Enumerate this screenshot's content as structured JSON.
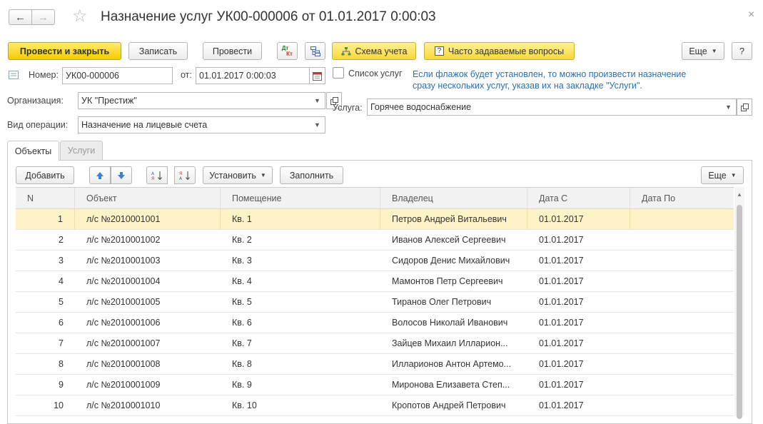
{
  "window": {
    "title": "Назначение услуг УК00-000006 от 01.01.2017 0:00:03",
    "back_glyph": "←",
    "forward_glyph": "→",
    "star_glyph": "☆",
    "close_glyph": "×"
  },
  "toolbar": {
    "post_close": "Провести и закрыть",
    "save": "Записать",
    "post": "Провести",
    "dt_kt_top": "Дт",
    "dt_kt_bottom": "Кт",
    "scheme": "Схема учета",
    "faq": "Часто задаваемые вопросы",
    "more": "Еще",
    "help": "?"
  },
  "form": {
    "number_label": "Номер:",
    "number_value": "УК00-000006",
    "date_label": "от:",
    "date_value": "01.01.2017  0:00:03",
    "org_label": "Организация:",
    "org_value": "УК \"Престиж\"",
    "op_label": "Вид операции:",
    "op_value": "Назначение на лицевые счета",
    "services_list_label": "Список услуг",
    "services_hint_1": "Если флажок будет установлен, то можно произвести назначение",
    "services_hint_2": "сразу нескольких услуг, указав их на закладке \"Услуги\".",
    "service_label": "Услуга:",
    "service_value": "Горячее водоснабжение"
  },
  "tabs": [
    {
      "label": "Объекты",
      "active": true
    },
    {
      "label": "Услуги",
      "active": false
    }
  ],
  "table_toolbar": {
    "add": "Добавить",
    "set": "Установить",
    "fill": "Заполнить",
    "more": "Еще"
  },
  "table": {
    "columns": [
      "N",
      "Объект",
      "Помещение",
      "Владелец",
      "Дата С",
      "Дата По"
    ],
    "rows": [
      {
        "n": "1",
        "object": "л/с №2010001001",
        "room": "Кв. 1",
        "owner": "Петров Андрей Витальевич",
        "date_from": "01.01.2017",
        "date_to": ""
      },
      {
        "n": "2",
        "object": "л/с №2010001002",
        "room": "Кв. 2",
        "owner": "Иванов Алексей Сергеевич",
        "date_from": "01.01.2017",
        "date_to": ""
      },
      {
        "n": "3",
        "object": "л/с №2010001003",
        "room": "Кв. 3",
        "owner": "Сидоров Денис Михайлович",
        "date_from": "01.01.2017",
        "date_to": ""
      },
      {
        "n": "4",
        "object": "л/с №2010001004",
        "room": "Кв. 4",
        "owner": "Мамонтов Петр Сергеевич",
        "date_from": "01.01.2017",
        "date_to": ""
      },
      {
        "n": "5",
        "object": "л/с №2010001005",
        "room": "Кв. 5",
        "owner": "Тиранов Олег Петрович",
        "date_from": "01.01.2017",
        "date_to": ""
      },
      {
        "n": "6",
        "object": "л/с №2010001006",
        "room": "Кв. 6",
        "owner": "Волосов Николай Иванович",
        "date_from": "01.01.2017",
        "date_to": ""
      },
      {
        "n": "7",
        "object": "л/с №2010001007",
        "room": "Кв. 7",
        "owner": "Зайцев Михаил Илларион...",
        "date_from": "01.01.2017",
        "date_to": ""
      },
      {
        "n": "8",
        "object": "л/с №2010001008",
        "room": "Кв. 8",
        "owner": "Илларионов Антон Артемо...",
        "date_from": "01.01.2017",
        "date_to": ""
      },
      {
        "n": "9",
        "object": "л/с №2010001009",
        "room": "Кв. 9",
        "owner": "Миронова Елизавета Степ...",
        "date_from": "01.01.2017",
        "date_to": ""
      },
      {
        "n": "10",
        "object": "л/с №2010001010",
        "room": "Кв. 10",
        "owner": "Кропотов Андрей Петрович",
        "date_from": "01.01.2017",
        "date_to": ""
      }
    ],
    "selected_row": 0
  },
  "colors": {
    "accent_yellow": "#f4cc00",
    "hint_blue": "#2a6fb3",
    "selected_row": "#fdf3c7"
  }
}
